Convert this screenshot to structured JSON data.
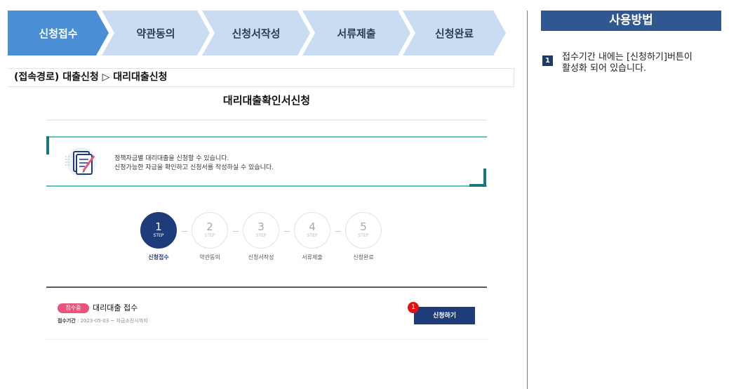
{
  "process_steps": [
    {
      "label": "신청접수",
      "active": true
    },
    {
      "label": "약관동의",
      "active": false
    },
    {
      "label": "신청서작성",
      "active": false
    },
    {
      "label": "서류제출",
      "active": false
    },
    {
      "label": "신청완료",
      "active": false
    }
  ],
  "breadcrumb": "(접속경로) 대출신청 ▷ 대리대출신청",
  "page": {
    "title": "대리대출확인서신청",
    "notice_line1": "정책자금별 대리대출을 신청할 수 있습니다.",
    "notice_line2": "신청가능한 자금을 확인하고 신청서를 작성하실 수 있습니다.",
    "notice_icon": "document-pen-icon",
    "steps": [
      {
        "num": "1",
        "sub": "STEP",
        "label": "신청접수",
        "active": true
      },
      {
        "num": "2",
        "sub": "STEP",
        "label": "약관동의",
        "active": false
      },
      {
        "num": "3",
        "sub": "STEP",
        "label": "신청서작성",
        "active": false
      },
      {
        "num": "4",
        "sub": "STEP",
        "label": "서류제출",
        "active": false
      },
      {
        "num": "5",
        "sub": "STEP",
        "label": "신청완료",
        "active": false
      }
    ],
    "loan": {
      "status": "접수중",
      "name": "대리대출 접수",
      "period_label": "접수기간",
      "period_value": " : 2023-05-03 ~ 자금소진시까지",
      "apply_button": "신청하기",
      "marker": "1"
    }
  },
  "help": {
    "title": "사용방법",
    "items": [
      {
        "num": "1",
        "line1": "접수기간 내에는 [신청하기]버튼이",
        "line2": "활성화 되어 있습니다."
      }
    ]
  },
  "colors": {
    "active_step": "#4a8fd6",
    "inactive_step": "#c9dcf1",
    "primary_navy": "#1e3b7a",
    "teal": "#60bfc4",
    "badge_pink": "#e8547b",
    "marker_red": "#e31212",
    "help_header": "#2f5891"
  }
}
